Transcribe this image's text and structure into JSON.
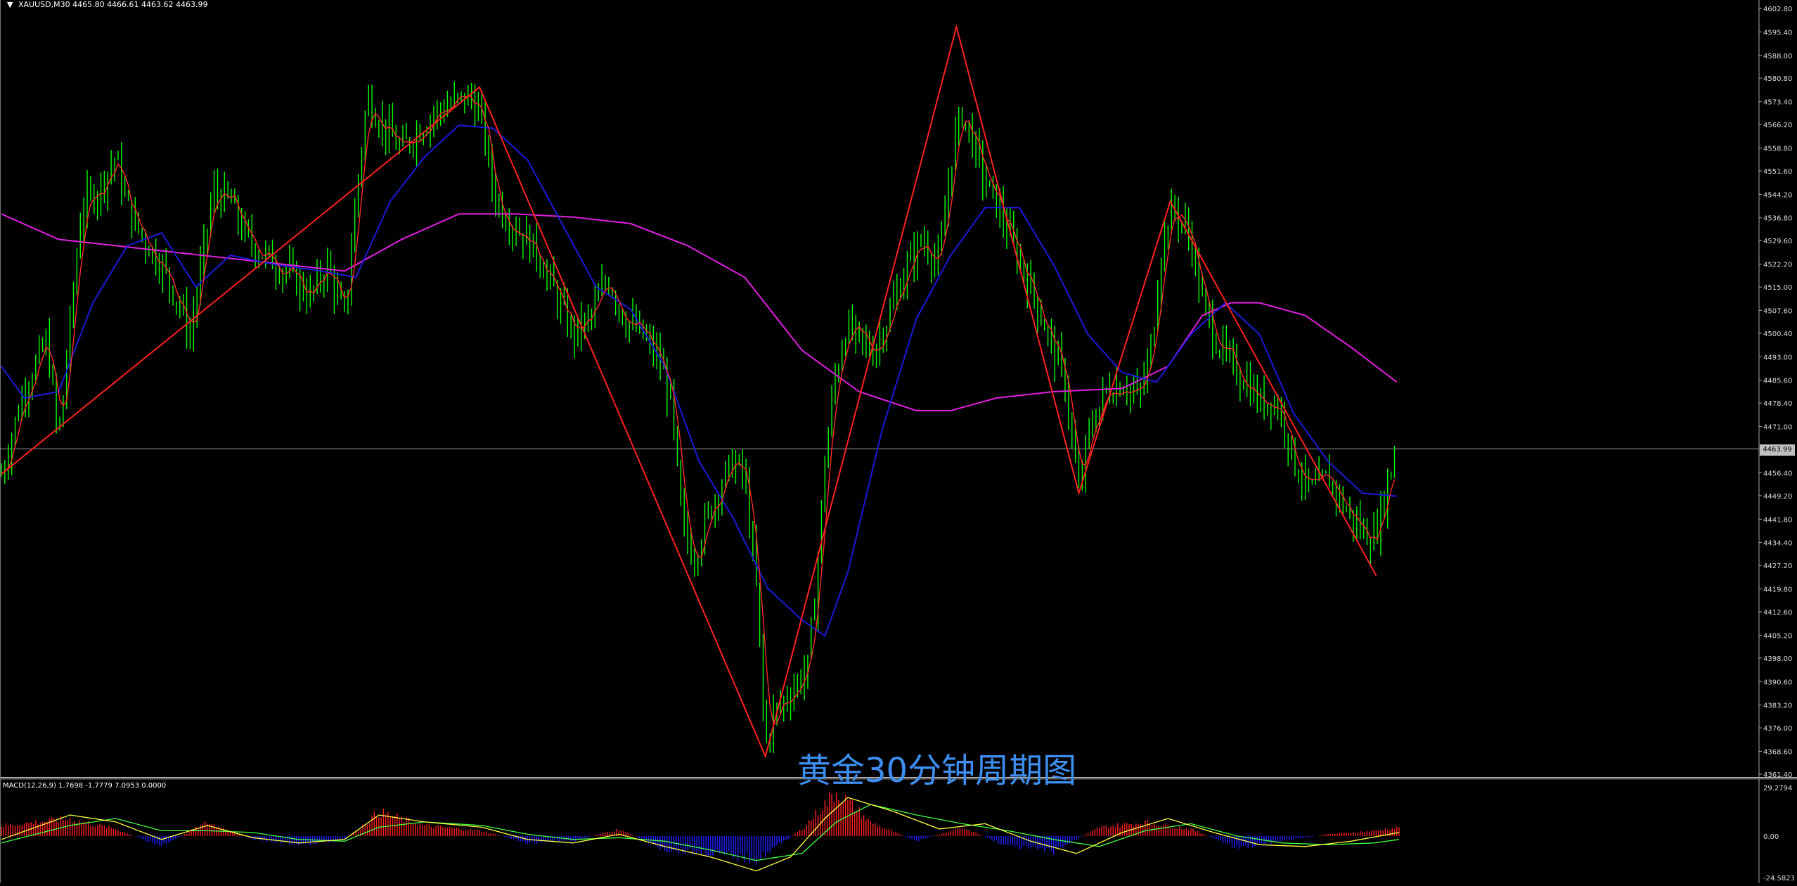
{
  "header": {
    "symbol": "XAUUSD,M30",
    "ohlc": "4465.80 4466.61 4463.62 4463.99",
    "current_price": "4463.99"
  },
  "watermark": "黄金30分钟周期图",
  "macd": {
    "label": "MACD(12,26,9) 1.7698 -1.7779 7.0953 0.0000",
    "axis_top": "29.2794",
    "axis_zero": "0.00",
    "axis_bottom": "-24.5823"
  },
  "colors": {
    "background": "#000000",
    "candle": "#00ff00",
    "ma_fast": "#ff2a2a",
    "ma_mid": "#1a1adc",
    "ma_slow": "#e020e0",
    "zigzag": "#ff2020",
    "macd_pos": "#ff2020",
    "macd_neg": "#2020ff",
    "macd_line": "#ffff40",
    "macd_signal": "#40ff40",
    "watermark": "#3d8ef0"
  },
  "chart_data": {
    "type": "candlestick",
    "y_axis": {
      "ticks": [
        "4602.80",
        "4595.40",
        "4588.00",
        "4580.80",
        "4573.40",
        "4566.20",
        "4558.80",
        "4551.60",
        "4544.20",
        "4536.80",
        "4529.60",
        "4522.20",
        "4515.00",
        "4507.60",
        "4500.40",
        "4493.00",
        "4485.60",
        "4478.40",
        "4471.00",
        "4456.40",
        "4449.20",
        "4441.80",
        "4434.40",
        "4427.20",
        "4419.80",
        "4412.60",
        "4405.20",
        "4398.00",
        "4390.60",
        "4383.20",
        "4376.00",
        "4368.60",
        "4361.40"
      ],
      "ylim": [
        4361.4,
        4602.8
      ]
    },
    "horizontal_line": 4463.99,
    "price_path": [
      [
        0,
        4456
      ],
      [
        20,
        4483
      ],
      [
        40,
        4498
      ],
      [
        50,
        4466
      ],
      [
        70,
        4540
      ],
      [
        85,
        4546
      ],
      [
        100,
        4556
      ],
      [
        110,
        4540
      ],
      [
        125,
        4530
      ],
      [
        140,
        4522
      ],
      [
        155,
        4510
      ],
      [
        165,
        4500
      ],
      [
        175,
        4522
      ],
      [
        185,
        4545
      ],
      [
        200,
        4542
      ],
      [
        215,
        4530
      ],
      [
        230,
        4525
      ],
      [
        250,
        4520
      ],
      [
        270,
        4512
      ],
      [
        285,
        4522
      ],
      [
        300,
        4505
      ],
      [
        312,
        4550
      ],
      [
        320,
        4575
      ],
      [
        335,
        4565
      ],
      [
        350,
        4558
      ],
      [
        365,
        4565
      ],
      [
        380,
        4570
      ],
      [
        395,
        4573
      ],
      [
        410,
        4575
      ],
      [
        420,
        4568
      ],
      [
        430,
        4545
      ],
      [
        440,
        4538
      ],
      [
        455,
        4532
      ],
      [
        470,
        4525
      ],
      [
        485,
        4512
      ],
      [
        500,
        4500
      ],
      [
        515,
        4505
      ],
      [
        530,
        4518
      ],
      [
        545,
        4505
      ],
      [
        560,
        4500
      ],
      [
        575,
        4492
      ],
      [
        585,
        4480
      ],
      [
        595,
        4440
      ],
      [
        605,
        4430
      ],
      [
        615,
        4440
      ],
      [
        625,
        4450
      ],
      [
        640,
        4460
      ],
      [
        650,
        4455
      ],
      [
        660,
        4420
      ],
      [
        668,
        4370
      ],
      [
        675,
        4380
      ],
      [
        685,
        4385
      ],
      [
        695,
        4390
      ],
      [
        705,
        4395
      ],
      [
        712,
        4420
      ],
      [
        720,
        4460
      ],
      [
        728,
        4485
      ],
      [
        738,
        4502
      ],
      [
        750,
        4498
      ],
      [
        762,
        4495
      ],
      [
        775,
        4505
      ],
      [
        790,
        4520
      ],
      [
        805,
        4530
      ],
      [
        820,
        4522
      ],
      [
        832,
        4560
      ],
      [
        840,
        4570
      ],
      [
        850,
        4560
      ],
      [
        860,
        4548
      ],
      [
        872,
        4540
      ],
      [
        885,
        4528
      ],
      [
        900,
        4515
      ],
      [
        915,
        4500
      ],
      [
        930,
        4485
      ],
      [
        942,
        4450
      ],
      [
        950,
        4468
      ],
      [
        965,
        4482
      ],
      [
        980,
        4485
      ],
      [
        995,
        4480
      ],
      [
        1005,
        4495
      ],
      [
        1015,
        4530
      ],
      [
        1025,
        4540
      ],
      [
        1040,
        4530
      ],
      [
        1050,
        4510
      ],
      [
        1060,
        4500
      ],
      [
        1075,
        4490
      ],
      [
        1090,
        4485
      ],
      [
        1100,
        4478
      ],
      [
        1110,
        4480
      ],
      [
        1120,
        4475
      ],
      [
        1130,
        4460
      ],
      [
        1145,
        4450
      ],
      [
        1160,
        4455
      ],
      [
        1175,
        4445
      ],
      [
        1190,
        4438
      ],
      [
        1200,
        4436
      ],
      [
        1210,
        4450
      ],
      [
        1218,
        4463
      ]
    ],
    "zigzag": [
      [
        0,
        4456
      ],
      [
        418,
        4578
      ],
      [
        668,
        4367
      ],
      [
        835,
        4597
      ],
      [
        942,
        4450
      ],
      [
        1022,
        4542
      ],
      [
        1202,
        4424
      ]
    ],
    "ma_mid": [
      [
        0,
        4490
      ],
      [
        20,
        4480
      ],
      [
        50,
        4482
      ],
      [
        80,
        4510
      ],
      [
        110,
        4528
      ],
      [
        140,
        4532
      ],
      [
        170,
        4515
      ],
      [
        200,
        4525
      ],
      [
        240,
        4522
      ],
      [
        280,
        4520
      ],
      [
        310,
        4518
      ],
      [
        340,
        4542
      ],
      [
        370,
        4556
      ],
      [
        400,
        4566
      ],
      [
        430,
        4565
      ],
      [
        460,
        4555
      ],
      [
        490,
        4535
      ],
      [
        520,
        4515
      ],
      [
        550,
        4508
      ],
      [
        580,
        4490
      ],
      [
        610,
        4460
      ],
      [
        640,
        4442
      ],
      [
        670,
        4420
      ],
      [
        700,
        4410
      ],
      [
        720,
        4405
      ],
      [
        740,
        4425
      ],
      [
        770,
        4470
      ],
      [
        800,
        4505
      ],
      [
        830,
        4525
      ],
      [
        860,
        4540
      ],
      [
        890,
        4540
      ],
      [
        920,
        4522
      ],
      [
        950,
        4500
      ],
      [
        980,
        4488
      ],
      [
        1010,
        4485
      ],
      [
        1040,
        4500
      ],
      [
        1070,
        4510
      ],
      [
        1100,
        4500
      ],
      [
        1130,
        4475
      ],
      [
        1160,
        4460
      ],
      [
        1190,
        4450
      ],
      [
        1220,
        4449
      ]
    ],
    "ma_slow": [
      [
        0,
        4538
      ],
      [
        50,
        4530
      ],
      [
        100,
        4528
      ],
      [
        150,
        4526
      ],
      [
        200,
        4524
      ],
      [
        250,
        4522
      ],
      [
        300,
        4520
      ],
      [
        350,
        4530
      ],
      [
        400,
        4538
      ],
      [
        450,
        4538
      ],
      [
        500,
        4537
      ],
      [
        550,
        4535
      ],
      [
        600,
        4528
      ],
      [
        650,
        4518
      ],
      [
        700,
        4495
      ],
      [
        750,
        4482
      ],
      [
        800,
        4476
      ],
      [
        830,
        4476
      ],
      [
        870,
        4480
      ],
      [
        920,
        4482
      ],
      [
        980,
        4483
      ],
      [
        1020,
        4490
      ],
      [
        1050,
        4506
      ],
      [
        1075,
        4510
      ],
      [
        1100,
        4510
      ],
      [
        1140,
        4506
      ],
      [
        1180,
        4496
      ],
      [
        1220,
        4485
      ]
    ],
    "macd_series": {
      "ylim": [
        -24.5823,
        29.2794
      ],
      "histogram_profile": [
        [
          0,
          6
        ],
        [
          60,
          10
        ],
        [
          100,
          4
        ],
        [
          140,
          -6
        ],
        [
          180,
          8
        ],
        [
          220,
          -2
        ],
        [
          260,
          -5
        ],
        [
          300,
          -3
        ],
        [
          330,
          14
        ],
        [
          370,
          6
        ],
        [
          420,
          3
        ],
        [
          460,
          -4
        ],
        [
          500,
          -3
        ],
        [
          540,
          4
        ],
        [
          580,
          -8
        ],
        [
          620,
          -10
        ],
        [
          660,
          -14
        ],
        [
          700,
          4
        ],
        [
          730,
          26
        ],
        [
          760,
          8
        ],
        [
          800,
          -3
        ],
        [
          840,
          5
        ],
        [
          880,
          -6
        ],
        [
          920,
          -9
        ],
        [
          960,
          5
        ],
        [
          1000,
          8
        ],
        [
          1040,
          4
        ],
        [
          1080,
          -7
        ],
        [
          1120,
          -3
        ],
        [
          1160,
          1
        ],
        [
          1200,
          3
        ],
        [
          1222,
          5
        ]
      ],
      "macd_line": [
        [
          0,
          -2
        ],
        [
          60,
          12
        ],
        [
          100,
          8
        ],
        [
          140,
          -2
        ],
        [
          180,
          6
        ],
        [
          220,
          -1
        ],
        [
          260,
          -4
        ],
        [
          300,
          -2
        ],
        [
          330,
          12
        ],
        [
          370,
          8
        ],
        [
          420,
          5
        ],
        [
          460,
          -2
        ],
        [
          500,
          -4
        ],
        [
          540,
          1
        ],
        [
          580,
          -6
        ],
        [
          620,
          -12
        ],
        [
          660,
          -20
        ],
        [
          690,
          -12
        ],
        [
          720,
          10
        ],
        [
          740,
          22
        ],
        [
          780,
          14
        ],
        [
          820,
          4
        ],
        [
          860,
          7
        ],
        [
          900,
          -3
        ],
        [
          940,
          -10
        ],
        [
          980,
          2
        ],
        [
          1020,
          10
        ],
        [
          1060,
          2
        ],
        [
          1100,
          -5
        ],
        [
          1140,
          -6
        ],
        [
          1180,
          -3
        ],
        [
          1222,
          2
        ]
      ],
      "signal_line": [
        [
          0,
          -4
        ],
        [
          60,
          6
        ],
        [
          100,
          10
        ],
        [
          140,
          3
        ],
        [
          180,
          3
        ],
        [
          220,
          2
        ],
        [
          260,
          -2
        ],
        [
          300,
          -3
        ],
        [
          330,
          5
        ],
        [
          370,
          8
        ],
        [
          420,
          6
        ],
        [
          460,
          1
        ],
        [
          500,
          -2
        ],
        [
          540,
          -1
        ],
        [
          580,
          -3
        ],
        [
          620,
          -8
        ],
        [
          660,
          -14
        ],
        [
          700,
          -10
        ],
        [
          730,
          8
        ],
        [
          760,
          18
        ],
        [
          800,
          12
        ],
        [
          840,
          7
        ],
        [
          880,
          3
        ],
        [
          920,
          -2
        ],
        [
          960,
          -6
        ],
        [
          1000,
          3
        ],
        [
          1040,
          7
        ],
        [
          1080,
          0
        ],
        [
          1120,
          -4
        ],
        [
          1160,
          -5
        ],
        [
          1200,
          -4
        ],
        [
          1222,
          -2
        ]
      ]
    }
  }
}
